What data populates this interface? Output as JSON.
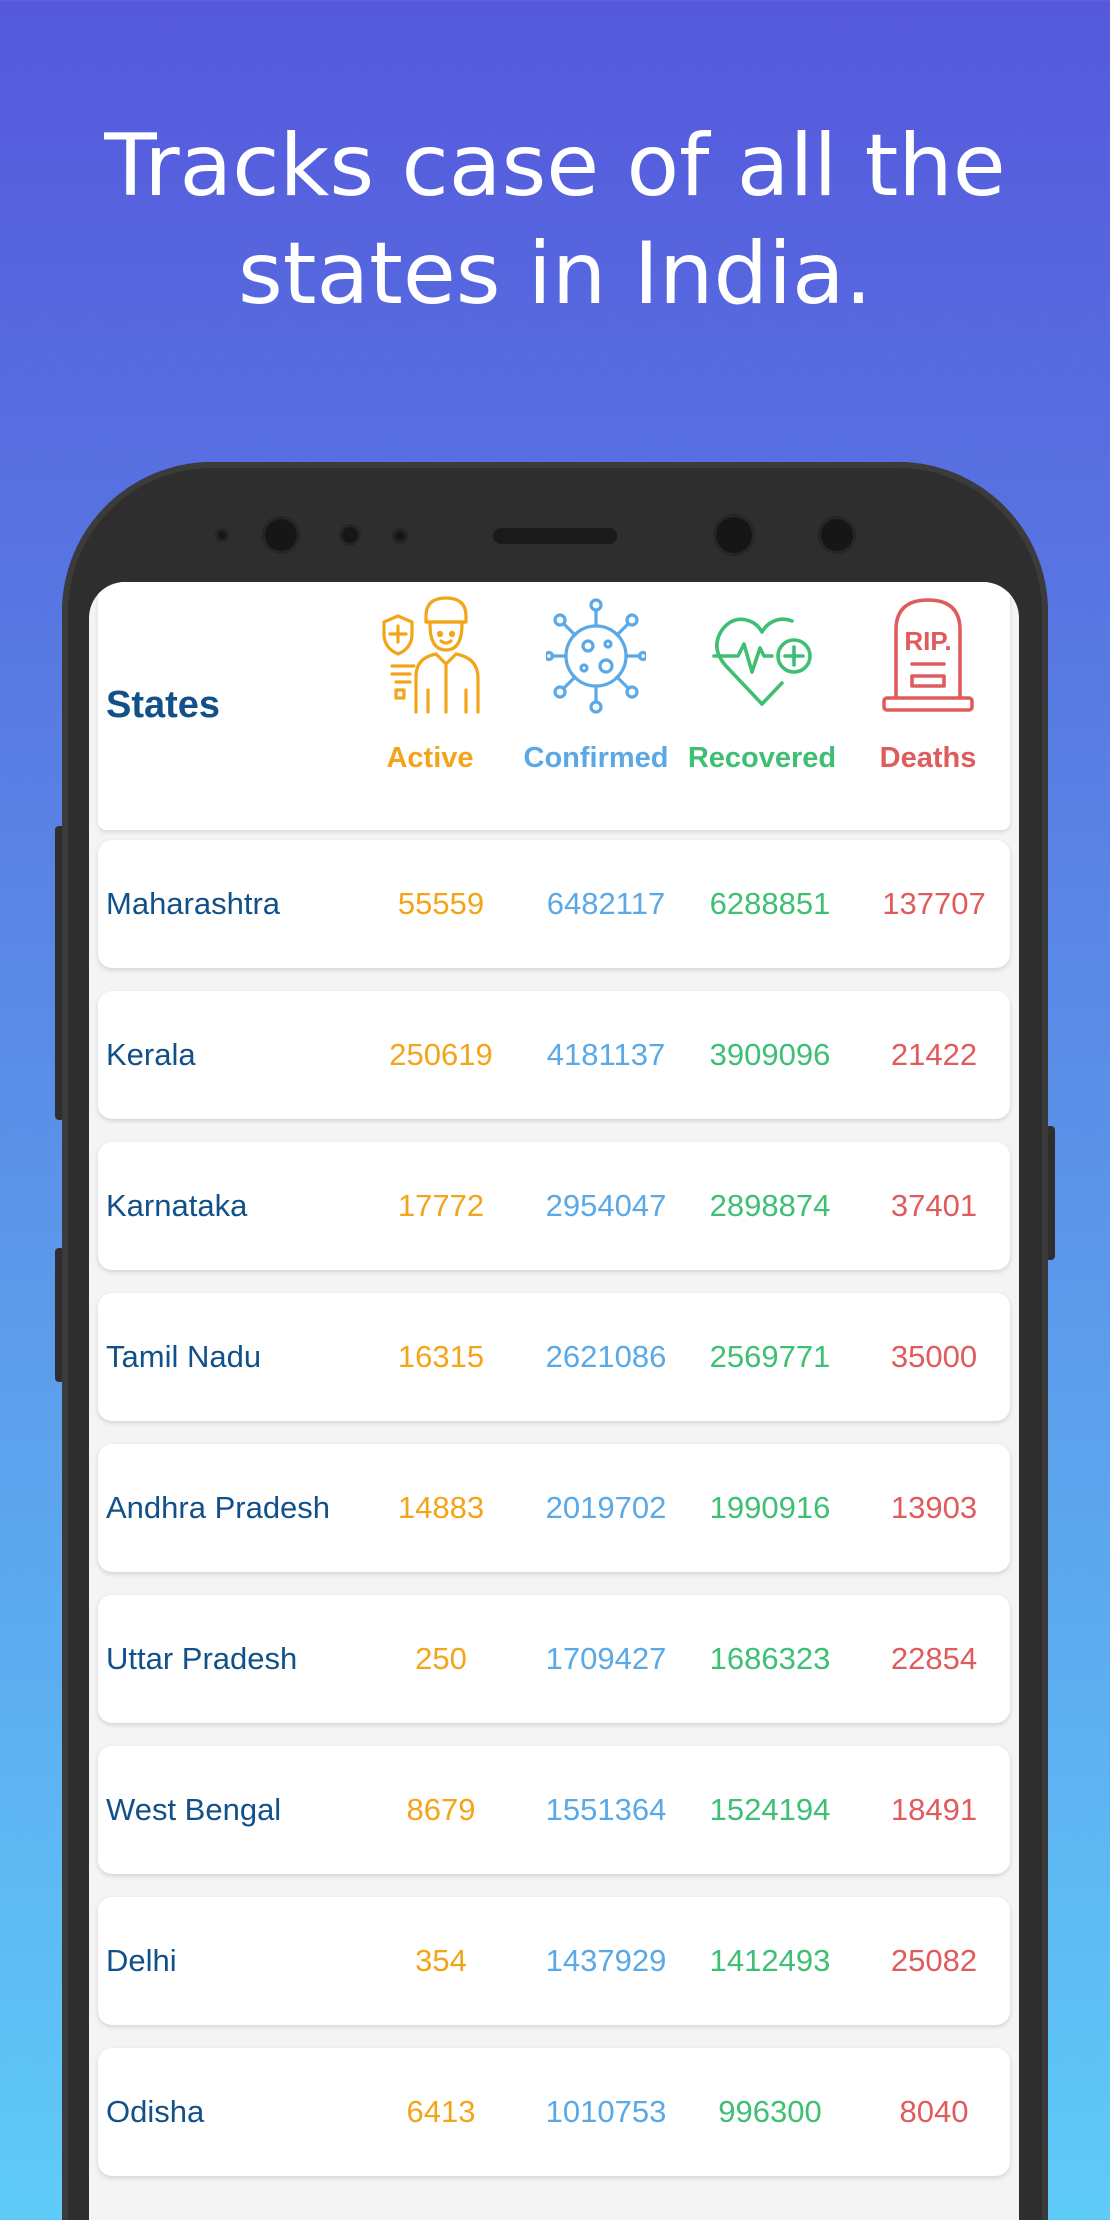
{
  "headline": {
    "line1": "Tracks case of all the",
    "line2": "states in India."
  },
  "colors": {
    "active": "#f3a51a",
    "confirmed": "#5aa9e6",
    "recovered": "#3fbf73",
    "deaths": "#e05b5b",
    "state": "#12508a"
  },
  "table": {
    "title": "States",
    "columns": [
      {
        "key": "active",
        "label": "Active",
        "icon": "health-worker-icon"
      },
      {
        "key": "confirmed",
        "label": "Confirmed",
        "icon": "virus-icon"
      },
      {
        "key": "recovered",
        "label": "Recovered",
        "icon": "heart-pulse-plus-icon"
      },
      {
        "key": "deaths",
        "label": "Deaths",
        "icon": "tombstone-icon"
      }
    ],
    "death_icon_text": "RIP.",
    "rows": [
      {
        "state": "Maharashtra",
        "active": "55559",
        "confirmed": "6482117",
        "recovered": "6288851",
        "deaths": "137707"
      },
      {
        "state": "Kerala",
        "active": "250619",
        "confirmed": "4181137",
        "recovered": "3909096",
        "deaths": "21422"
      },
      {
        "state": "Karnataka",
        "active": "17772",
        "confirmed": "2954047",
        "recovered": "2898874",
        "deaths": "37401"
      },
      {
        "state": "Tamil Nadu",
        "active": "16315",
        "confirmed": "2621086",
        "recovered": "2569771",
        "deaths": "35000"
      },
      {
        "state": "Andhra Pradesh",
        "active": "14883",
        "confirmed": "2019702",
        "recovered": "1990916",
        "deaths": "13903"
      },
      {
        "state": "Uttar Pradesh",
        "active": "250",
        "confirmed": "1709427",
        "recovered": "1686323",
        "deaths": "22854"
      },
      {
        "state": "West Bengal",
        "active": "8679",
        "confirmed": "1551364",
        "recovered": "1524194",
        "deaths": "18491"
      },
      {
        "state": "Delhi",
        "active": "354",
        "confirmed": "1437929",
        "recovered": "1412493",
        "deaths": "25082"
      },
      {
        "state": "Odisha",
        "active": "6413",
        "confirmed": "1010753",
        "recovered": "996300",
        "deaths": "8040"
      }
    ]
  }
}
